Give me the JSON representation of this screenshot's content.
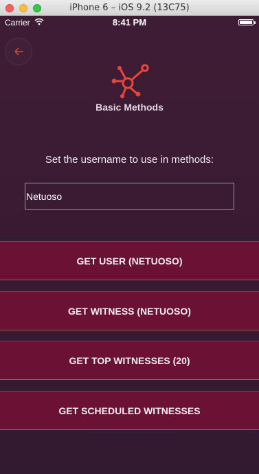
{
  "window": {
    "title": "iPhone 6 – iOS 9.2 (13C75)"
  },
  "status_bar": {
    "carrier": "Carrier",
    "time": "8:41 PM"
  },
  "icons": {
    "back": "back-arrow-icon",
    "logo": "network-nodes-icon",
    "wifi": "wifi-icon",
    "battery": "battery-icon"
  },
  "colors": {
    "background": "#3a1a33",
    "button": "#6b1133",
    "accent": "#e8453c"
  },
  "screen": {
    "title": "Basic Methods",
    "instruction": "Set the username to use in methods:",
    "username_value": "Netuoso"
  },
  "buttons": [
    {
      "label": "GET USER (NETUOSO)"
    },
    {
      "label": "GET WITNESS (NETUOSO)"
    },
    {
      "label": "GET TOP WITNESSES (20)"
    },
    {
      "label": "GET SCHEDULED WITNESSES"
    }
  ]
}
